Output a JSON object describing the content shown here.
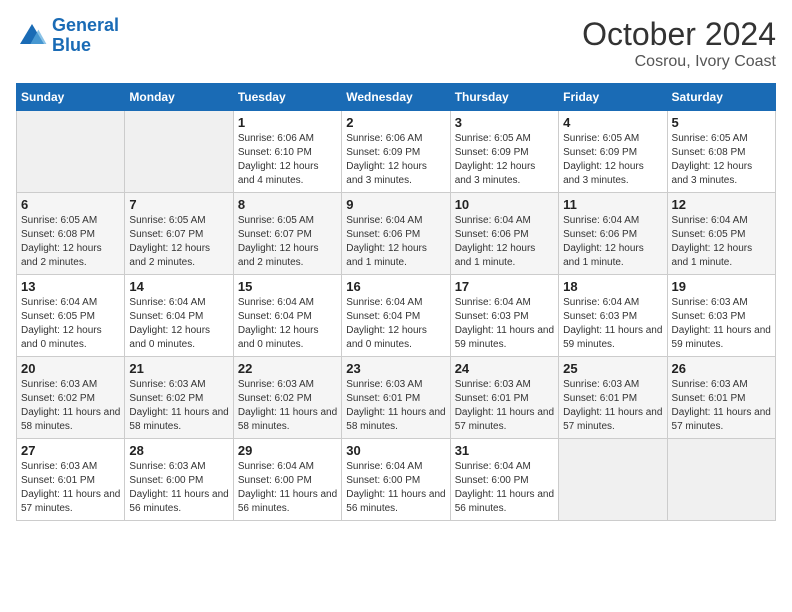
{
  "header": {
    "logo_line1": "General",
    "logo_line2": "Blue",
    "title": "October 2024",
    "subtitle": "Cosrou, Ivory Coast"
  },
  "weekdays": [
    "Sunday",
    "Monday",
    "Tuesday",
    "Wednesday",
    "Thursday",
    "Friday",
    "Saturday"
  ],
  "weeks": [
    [
      {
        "num": "",
        "info": ""
      },
      {
        "num": "",
        "info": ""
      },
      {
        "num": "1",
        "info": "Sunrise: 6:06 AM\nSunset: 6:10 PM\nDaylight: 12 hours and 4 minutes."
      },
      {
        "num": "2",
        "info": "Sunrise: 6:06 AM\nSunset: 6:09 PM\nDaylight: 12 hours and 3 minutes."
      },
      {
        "num": "3",
        "info": "Sunrise: 6:05 AM\nSunset: 6:09 PM\nDaylight: 12 hours and 3 minutes."
      },
      {
        "num": "4",
        "info": "Sunrise: 6:05 AM\nSunset: 6:09 PM\nDaylight: 12 hours and 3 minutes."
      },
      {
        "num": "5",
        "info": "Sunrise: 6:05 AM\nSunset: 6:08 PM\nDaylight: 12 hours and 3 minutes."
      }
    ],
    [
      {
        "num": "6",
        "info": "Sunrise: 6:05 AM\nSunset: 6:08 PM\nDaylight: 12 hours and 2 minutes."
      },
      {
        "num": "7",
        "info": "Sunrise: 6:05 AM\nSunset: 6:07 PM\nDaylight: 12 hours and 2 minutes."
      },
      {
        "num": "8",
        "info": "Sunrise: 6:05 AM\nSunset: 6:07 PM\nDaylight: 12 hours and 2 minutes."
      },
      {
        "num": "9",
        "info": "Sunrise: 6:04 AM\nSunset: 6:06 PM\nDaylight: 12 hours and 1 minute."
      },
      {
        "num": "10",
        "info": "Sunrise: 6:04 AM\nSunset: 6:06 PM\nDaylight: 12 hours and 1 minute."
      },
      {
        "num": "11",
        "info": "Sunrise: 6:04 AM\nSunset: 6:06 PM\nDaylight: 12 hours and 1 minute."
      },
      {
        "num": "12",
        "info": "Sunrise: 6:04 AM\nSunset: 6:05 PM\nDaylight: 12 hours and 1 minute."
      }
    ],
    [
      {
        "num": "13",
        "info": "Sunrise: 6:04 AM\nSunset: 6:05 PM\nDaylight: 12 hours and 0 minutes."
      },
      {
        "num": "14",
        "info": "Sunrise: 6:04 AM\nSunset: 6:04 PM\nDaylight: 12 hours and 0 minutes."
      },
      {
        "num": "15",
        "info": "Sunrise: 6:04 AM\nSunset: 6:04 PM\nDaylight: 12 hours and 0 minutes."
      },
      {
        "num": "16",
        "info": "Sunrise: 6:04 AM\nSunset: 6:04 PM\nDaylight: 12 hours and 0 minutes."
      },
      {
        "num": "17",
        "info": "Sunrise: 6:04 AM\nSunset: 6:03 PM\nDaylight: 11 hours and 59 minutes."
      },
      {
        "num": "18",
        "info": "Sunrise: 6:04 AM\nSunset: 6:03 PM\nDaylight: 11 hours and 59 minutes."
      },
      {
        "num": "19",
        "info": "Sunrise: 6:03 AM\nSunset: 6:03 PM\nDaylight: 11 hours and 59 minutes."
      }
    ],
    [
      {
        "num": "20",
        "info": "Sunrise: 6:03 AM\nSunset: 6:02 PM\nDaylight: 11 hours and 58 minutes."
      },
      {
        "num": "21",
        "info": "Sunrise: 6:03 AM\nSunset: 6:02 PM\nDaylight: 11 hours and 58 minutes."
      },
      {
        "num": "22",
        "info": "Sunrise: 6:03 AM\nSunset: 6:02 PM\nDaylight: 11 hours and 58 minutes."
      },
      {
        "num": "23",
        "info": "Sunrise: 6:03 AM\nSunset: 6:01 PM\nDaylight: 11 hours and 58 minutes."
      },
      {
        "num": "24",
        "info": "Sunrise: 6:03 AM\nSunset: 6:01 PM\nDaylight: 11 hours and 57 minutes."
      },
      {
        "num": "25",
        "info": "Sunrise: 6:03 AM\nSunset: 6:01 PM\nDaylight: 11 hours and 57 minutes."
      },
      {
        "num": "26",
        "info": "Sunrise: 6:03 AM\nSunset: 6:01 PM\nDaylight: 11 hours and 57 minutes."
      }
    ],
    [
      {
        "num": "27",
        "info": "Sunrise: 6:03 AM\nSunset: 6:01 PM\nDaylight: 11 hours and 57 minutes."
      },
      {
        "num": "28",
        "info": "Sunrise: 6:03 AM\nSunset: 6:00 PM\nDaylight: 11 hours and 56 minutes."
      },
      {
        "num": "29",
        "info": "Sunrise: 6:04 AM\nSunset: 6:00 PM\nDaylight: 11 hours and 56 minutes."
      },
      {
        "num": "30",
        "info": "Sunrise: 6:04 AM\nSunset: 6:00 PM\nDaylight: 11 hours and 56 minutes."
      },
      {
        "num": "31",
        "info": "Sunrise: 6:04 AM\nSunset: 6:00 PM\nDaylight: 11 hours and 56 minutes."
      },
      {
        "num": "",
        "info": ""
      },
      {
        "num": "",
        "info": ""
      }
    ]
  ]
}
